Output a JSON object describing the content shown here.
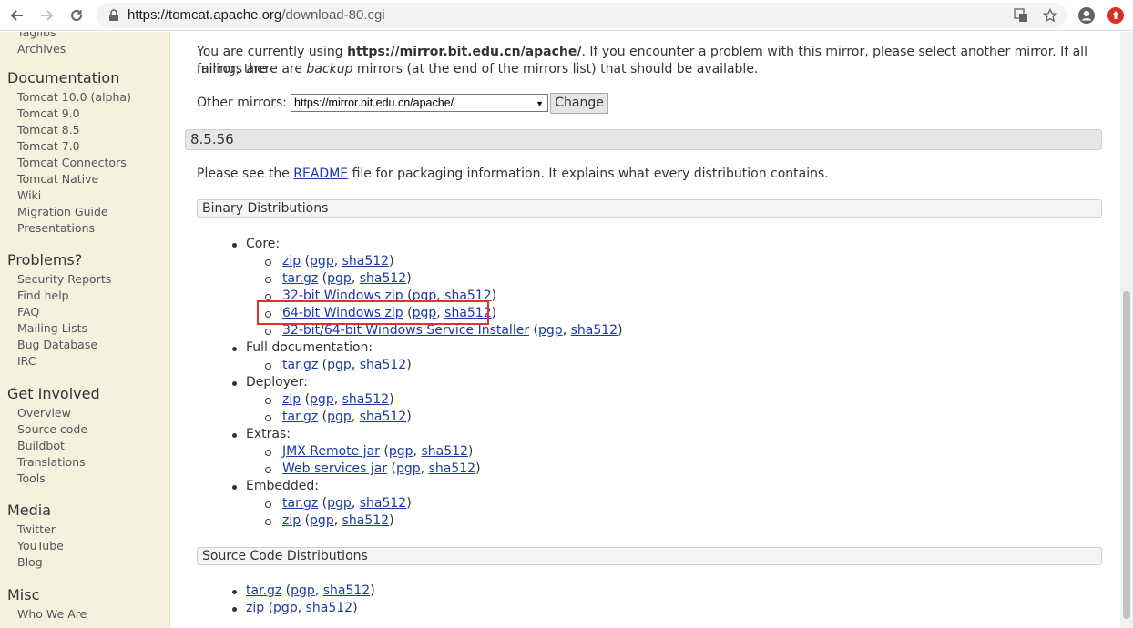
{
  "browser": {
    "url_host": "https://tomcat.apache.org",
    "url_path": "/download-80.cgi"
  },
  "sidebar": {
    "top_links": [
      "Taglibs",
      "Archives"
    ],
    "groups": [
      {
        "heading": "Documentation",
        "items": [
          "Tomcat 10.0 (alpha)",
          "Tomcat 9.0",
          "Tomcat 8.5",
          "Tomcat 7.0",
          "Tomcat Connectors",
          "Tomcat Native",
          "Wiki",
          "Migration Guide",
          "Presentations"
        ]
      },
      {
        "heading": "Problems?",
        "items": [
          "Security Reports",
          "Find help",
          "FAQ",
          "Mailing Lists",
          "Bug Database",
          "IRC"
        ]
      },
      {
        "heading": "Get Involved",
        "items": [
          "Overview",
          "Source code",
          "Buildbot",
          "Translations",
          "Tools"
        ]
      },
      {
        "heading": "Media",
        "items": [
          "Twitter",
          "YouTube",
          "Blog"
        ]
      },
      {
        "heading": "Misc",
        "items": [
          "Who We Are"
        ]
      }
    ]
  },
  "main": {
    "mirror_notice": {
      "prefix": "You are currently using ",
      "mirror": "https://mirror.bit.edu.cn/apache/",
      "suffix1": ". If you encounter a problem with this mirror, please select another mirror. If all mirrors are",
      "line2_prefix": "failing, there are ",
      "backup": "backup",
      "line2_suffix": " mirrors (at the end of the mirrors list) that should be available."
    },
    "other_mirrors_label": "Other mirrors:",
    "mirror_select_value": "https://mirror.bit.edu.cn/apache/",
    "change_button": "Change",
    "version": "8.5.56",
    "readme_prefix": "Please see the ",
    "readme_link": "README",
    "readme_suffix": " file for packaging information. It explains what every distribution contains.",
    "binary_heading": "Binary Distributions",
    "source_heading": "Source Code Distributions",
    "core_label": "Core:",
    "fulldoc_label": "Full documentation:",
    "deployer_label": "Deployer:",
    "extras_label": "Extras:",
    "embedded_label": "Embedded:",
    "links": {
      "zip": "zip",
      "targz": "tar.gz",
      "win32": "32-bit Windows zip",
      "win64": "64-bit Windows zip",
      "installer": "32-bit/64-bit Windows Service Installer",
      "jmx": "JMX Remote jar",
      "ws": "Web services jar",
      "pgp": "pgp",
      "sha512": "sha512"
    }
  }
}
